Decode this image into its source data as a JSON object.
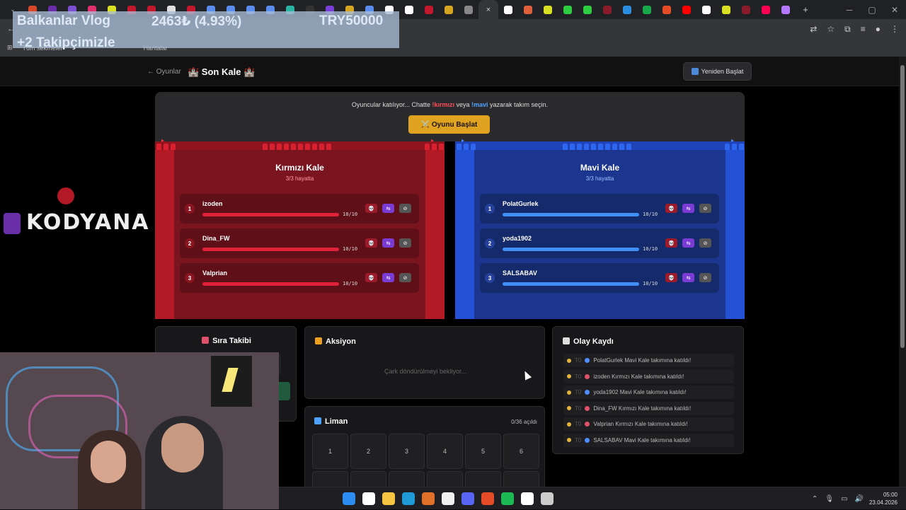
{
  "browser": {
    "tab_colors": [
      "#d9472b",
      "#6a2fa8",
      "#7b4fd1",
      "#e1306c",
      "#d9e021",
      "#c2182b",
      "#c2182b",
      "#e0e0e0",
      "#c2182b",
      "#5b8def",
      "#5b8def",
      "#5b8def",
      "#5b8def",
      "#2bb3a3",
      "#333",
      "#7a3fd6",
      "#d6a421",
      "#5b8def",
      "#ffffff",
      "#ffffff",
      "#c2182b",
      "#d6a421",
      "#888"
    ],
    "active_tab_close": "×",
    "right_tab_colors": [
      "#ffffff",
      "#e0603b",
      "#d9e021",
      "#2ecc40",
      "#2ecc40",
      "#8a1c2a",
      "#2b8de0",
      "#18a84a",
      "#e34c26",
      "#ff0000",
      "#ffffff",
      "#d9e021",
      "#8a1c2a",
      "#ff0050",
      "#b478ff"
    ],
    "new_tab": "+",
    "minimize": "─",
    "restore": "▢",
    "close": "✕",
    "bookmarks": [
      "Tüm sekmeler",
      "Haritalar"
    ]
  },
  "overlay": {
    "channel": "Balkanlar Vlog",
    "amount": "2463₺ (4.93%)",
    "goal": "TRY50000",
    "followers": "+2 Takipçimizle"
  },
  "nav": {
    "back_label": "← Oyunlar",
    "title": "🏰 Son Kale 🏰",
    "restart_label": "Yeniden Başlat"
  },
  "info": {
    "text_before": "Oyuncular katılıyor... Chatte ",
    "red_cmd": "!kırmızı",
    "text_mid": " veya ",
    "blue_cmd": "!mavi",
    "text_after": " yazarak takım seçin.",
    "start_label": "⚔️ Oyunu Başlat"
  },
  "red_castle": {
    "title": "Kırmızı Kale",
    "alive": "3/3 hayatta",
    "players": [
      {
        "num": "1",
        "name": "izoden",
        "hp": "10/10",
        "hp_frac": 1.0
      },
      {
        "num": "2",
        "name": "Dina_FW",
        "hp": "10/10",
        "hp_frac": 1.0
      },
      {
        "num": "3",
        "name": "Valprian",
        "hp": "10/10",
        "hp_frac": 1.0
      }
    ]
  },
  "blue_castle": {
    "title": "Mavi Kale",
    "alive": "3/3 hayatta",
    "players": [
      {
        "num": "1",
        "name": "PolatGurlek",
        "hp": "10/10",
        "hp_frac": 1.0
      },
      {
        "num": "2",
        "name": "yoda1902",
        "hp": "10/10",
        "hp_frac": 1.0
      },
      {
        "num": "3",
        "name": "SALSABAV",
        "hp": "10/10",
        "hp_frac": 1.0
      }
    ]
  },
  "player_actions": {
    "kill": "💀",
    "swap": "⇆",
    "ban": "⊘"
  },
  "logo": {
    "text": "KODYANA"
  },
  "turn": {
    "title": "Sıra Takibi"
  },
  "action": {
    "title": "Aksiyon",
    "waiting": "Çark döndürülmeyi bekliyor..."
  },
  "port": {
    "title": "Liman",
    "count": "0/36 açıldı",
    "cells": [
      "1",
      "2",
      "3",
      "4",
      "5",
      "6",
      "",
      "",
      "",
      "",
      "",
      ""
    ]
  },
  "log": {
    "title": "Olay Kaydı",
    "items": [
      {
        "time": "T0",
        "team": "blue",
        "text": "PolatGurlek Mavi Kale takımına katıldı!"
      },
      {
        "time": "T0",
        "team": "red",
        "text": "izoden Kırmızı Kale takımına katıldı!"
      },
      {
        "time": "T0",
        "team": "blue",
        "text": "yoda1902 Mavi Kale takımına katıldı!"
      },
      {
        "time": "T0",
        "team": "red",
        "text": "Dina_FW Kırmızı Kale takımına katıldı!"
      },
      {
        "time": "T0",
        "team": "red",
        "text": "Valprian Kırmızı Kale takımına katıldı!"
      },
      {
        "time": "T0",
        "team": "blue",
        "text": "SALSABAV Mavi Kale takımına katıldı!"
      }
    ]
  },
  "colors": {
    "red_team": "#e0506a",
    "blue_team": "#4f8cff"
  },
  "taskbar": {
    "icon_colors": [
      "#2d8cf0",
      "#ffffff",
      "#f5c542",
      "#1f9ad6",
      "#e06f2a",
      "#f0f0f0",
      "#5865f2",
      "#e34c26",
      "#1db954",
      "#ffffff",
      "#cccccc"
    ],
    "time": "05:00",
    "date": "23.04.2026"
  }
}
